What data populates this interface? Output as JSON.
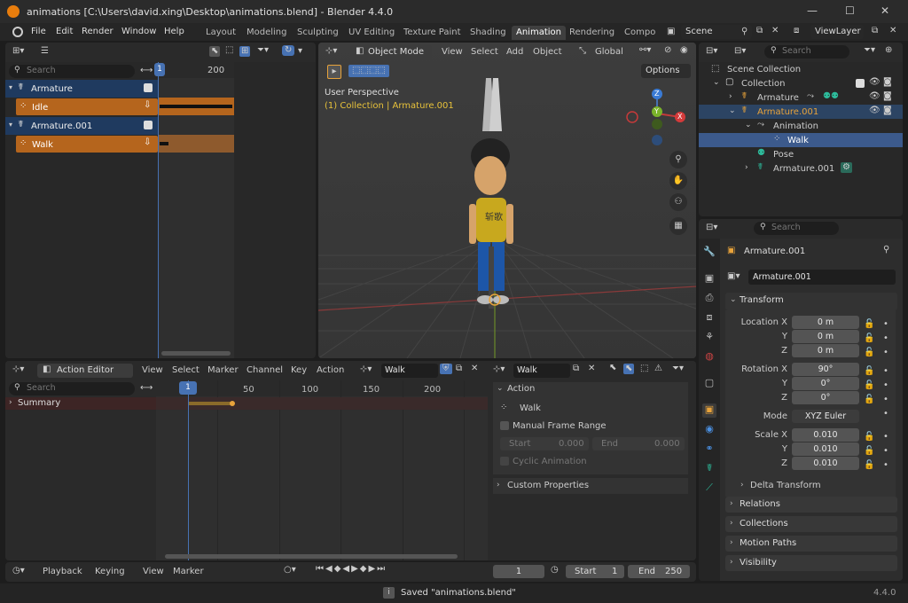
{
  "window": {
    "title": "animations [C:\\Users\\david.xing\\Desktop\\animations.blend] - Blender 4.4.0",
    "minimize": "—",
    "maximize": "☐",
    "close": "✕"
  },
  "menu": [
    "File",
    "Edit",
    "Render",
    "Window",
    "Help"
  ],
  "workspaces": [
    "Layout",
    "Modeling",
    "Sculpting",
    "UV Editing",
    "Texture Paint",
    "Shading",
    "Animation",
    "Rendering",
    "Compo"
  ],
  "scene": {
    "name": "Scene",
    "view_layer": "ViewLayer"
  },
  "nla": {
    "search_placeholder": "Search",
    "frame_current": "1",
    "frame_tick": "200",
    "tracks": [
      {
        "name": "Armature",
        "strip": "Idle"
      },
      {
        "name": "Armature.001",
        "strip": "Walk"
      }
    ]
  },
  "viewport": {
    "mode": "Object Mode",
    "menus": [
      "View",
      "Select",
      "Add",
      "Object"
    ],
    "transform_orientation": "Global",
    "options": "Options",
    "perspective": "User Perspective",
    "context": "(1) Collection | Armature.001",
    "shirt_text": "斩歌",
    "gizmo": {
      "z": "Z",
      "y": "Y",
      "x": "X"
    }
  },
  "action_editor": {
    "mode": "Action Editor",
    "menus": [
      "View",
      "Select",
      "Marker",
      "Channel",
      "Key",
      "Action"
    ],
    "action_name": "Walk",
    "action_field": "Walk",
    "search_placeholder": "Search",
    "summary": "Summary",
    "ticks": [
      "1",
      "50",
      "100",
      "150",
      "200"
    ],
    "side": {
      "action_header": "Action",
      "action_name": "Walk",
      "manual_frame_range": "Manual Frame Range",
      "start_label": "Start",
      "start_value": "0.000",
      "end_label": "End",
      "end_value": "0.000",
      "cyclic": "Cyclic Animation",
      "custom_props": "Custom Properties"
    }
  },
  "timeline": {
    "menus": [
      "Playback",
      "Keying",
      "View",
      "Marker"
    ],
    "current": "1",
    "start_label": "Start",
    "start": "1",
    "end_label": "End",
    "end": "250"
  },
  "outliner": {
    "search_placeholder": "Search",
    "rows": [
      {
        "label": "Scene Collection"
      },
      {
        "label": "Collection"
      },
      {
        "label": "Armature"
      },
      {
        "label": "Armature.001"
      },
      {
        "label": "Animation"
      },
      {
        "label": "Walk"
      },
      {
        "label": "Pose"
      },
      {
        "label": "Armature.001"
      }
    ]
  },
  "properties": {
    "search_placeholder": "Search",
    "object_name": "Armature.001",
    "object_field": "Armature.001",
    "transform_header": "Transform",
    "location_label": "Location X",
    "location": [
      "0 m",
      "0 m",
      "0 m"
    ],
    "rotation_label": "Rotation X",
    "rotation": [
      "90°",
      "0°",
      "0°"
    ],
    "y_label": "Y",
    "z_label": "Z",
    "mode_label": "Mode",
    "mode": "XYZ Euler",
    "scale_label": "Scale X",
    "scale": [
      "0.010",
      "0.010",
      "0.010"
    ],
    "delta_transform": "Delta Transform",
    "sections": [
      "Relations",
      "Collections",
      "Motion Paths",
      "Visibility"
    ]
  },
  "status": {
    "message": "Saved \"animations.blend\"",
    "version": "4.4.0"
  },
  "colors": {
    "accent": "#4772b3",
    "strip": "#b5651d",
    "selected_track": "#1f3a5f",
    "summary": "#3d2525"
  }
}
